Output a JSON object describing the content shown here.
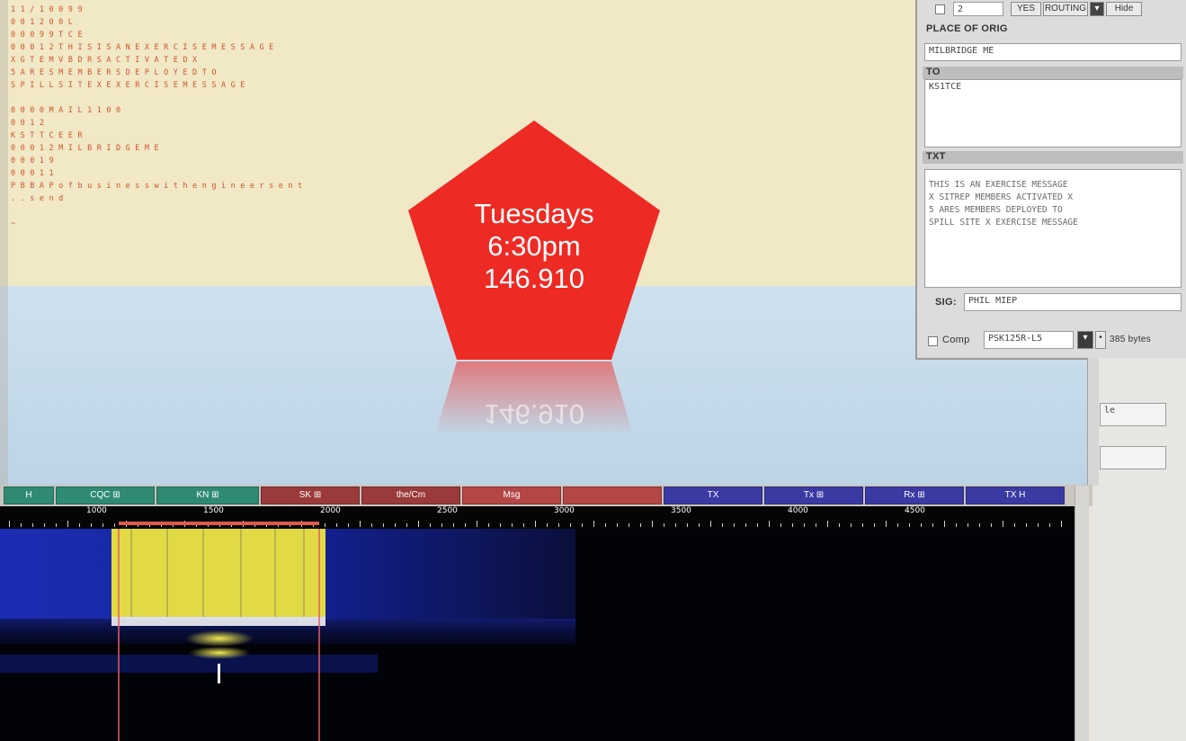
{
  "rx_text": {
    "lines": [
      "1 1 / 1 0 0 9 9",
      "0 0 1 2 0 0 L",
      "0 0 0 9 9 T C E",
      "0 0 0 1 2 T H I S  I S  A N  E X E R C I S E  M E S S A G E",
      "X G T E M V B D R S  A C T I V A T E D  X",
      "5 A R E S  M E M B E R S  D E P L O Y E D  T O",
      "S P I L L  S I T E  X  E X E R C I S E  M E S S A G E",
      "",
      "0 0 0 0  M A I L  1 1 0 0",
      "0 0 1 2",
      "K S T T C E  E R",
      "0 0 0 1 2  M I L B R I D G E  M E",
      "0 0 0 1 9",
      "0 0 0 1 1",
      "P B B A P  o f  b u s i n e s s  w i t h  e n g i n e e r  s e n t",
      ". . s e n d",
      "",
      "~"
    ]
  },
  "form": {
    "top_field": "2",
    "top_buttons": [
      "YES",
      "ROUTING",
      "▾",
      "Hide"
    ],
    "place_of_orig_label": "PLACE OF ORIG",
    "place_of_orig_value": "MILBRIDGE ME",
    "to_label": "TO",
    "to_value": "KS1TCE",
    "txt_label": "TXT",
    "txt_lines": [
      "THIS IS AN EXERCISE MESSAGE",
      "X SITREP MEMBERS ACTIVATED X",
      "5 ARES MEMBERS DEPLOYED TO",
      "SPILL SITE X EXERCISE MESSAGE"
    ],
    "sig_label": "SIG:",
    "sig_value": "PHIL MIEP",
    "comp_label": "Comp",
    "mode_value": "PSK125R-L5",
    "size_text": "385 bytes"
  },
  "right_panel": {
    "select1": "le",
    "select2": ""
  },
  "macro_buttons": [
    {
      "label": "H",
      "color": "#2f8a74"
    },
    {
      "label": "CQC ⊞",
      "color": "#2f8a74"
    },
    {
      "label": "KN ⊞",
      "color": "#2f8a74"
    },
    {
      "label": "SK ⊞",
      "color": "#9a3a3a"
    },
    {
      "label": "the/Cm",
      "color": "#9a3a3a"
    },
    {
      "label": "Msg",
      "color": "#b44646"
    },
    {
      "label": "",
      "color": "#b44646"
    },
    {
      "label": "TX",
      "color": "#3a3aa3"
    },
    {
      "label": "Tx ⊞",
      "color": "#3a3aa3"
    },
    {
      "label": "Rx ⊞",
      "color": "#3a3aa3"
    },
    {
      "label": "TX H",
      "color": "#3a3aa3"
    }
  ],
  "ruler": {
    "labels": [
      "1000",
      "1500",
      "2000",
      "2500",
      "3000",
      "3500",
      "4000",
      "4500"
    ]
  },
  "overlay": {
    "line1": "Tuesdays",
    "line2": "6:30pm",
    "line3": "146.910",
    "reflection": "146.910",
    "color": "#ee2a24"
  },
  "colors": {
    "rx_background": "#f1e8c6",
    "rx_text": "#d0542a",
    "waterfall_signal": "#e8e04a",
    "waterfall_noise": "#1a2aa8"
  }
}
